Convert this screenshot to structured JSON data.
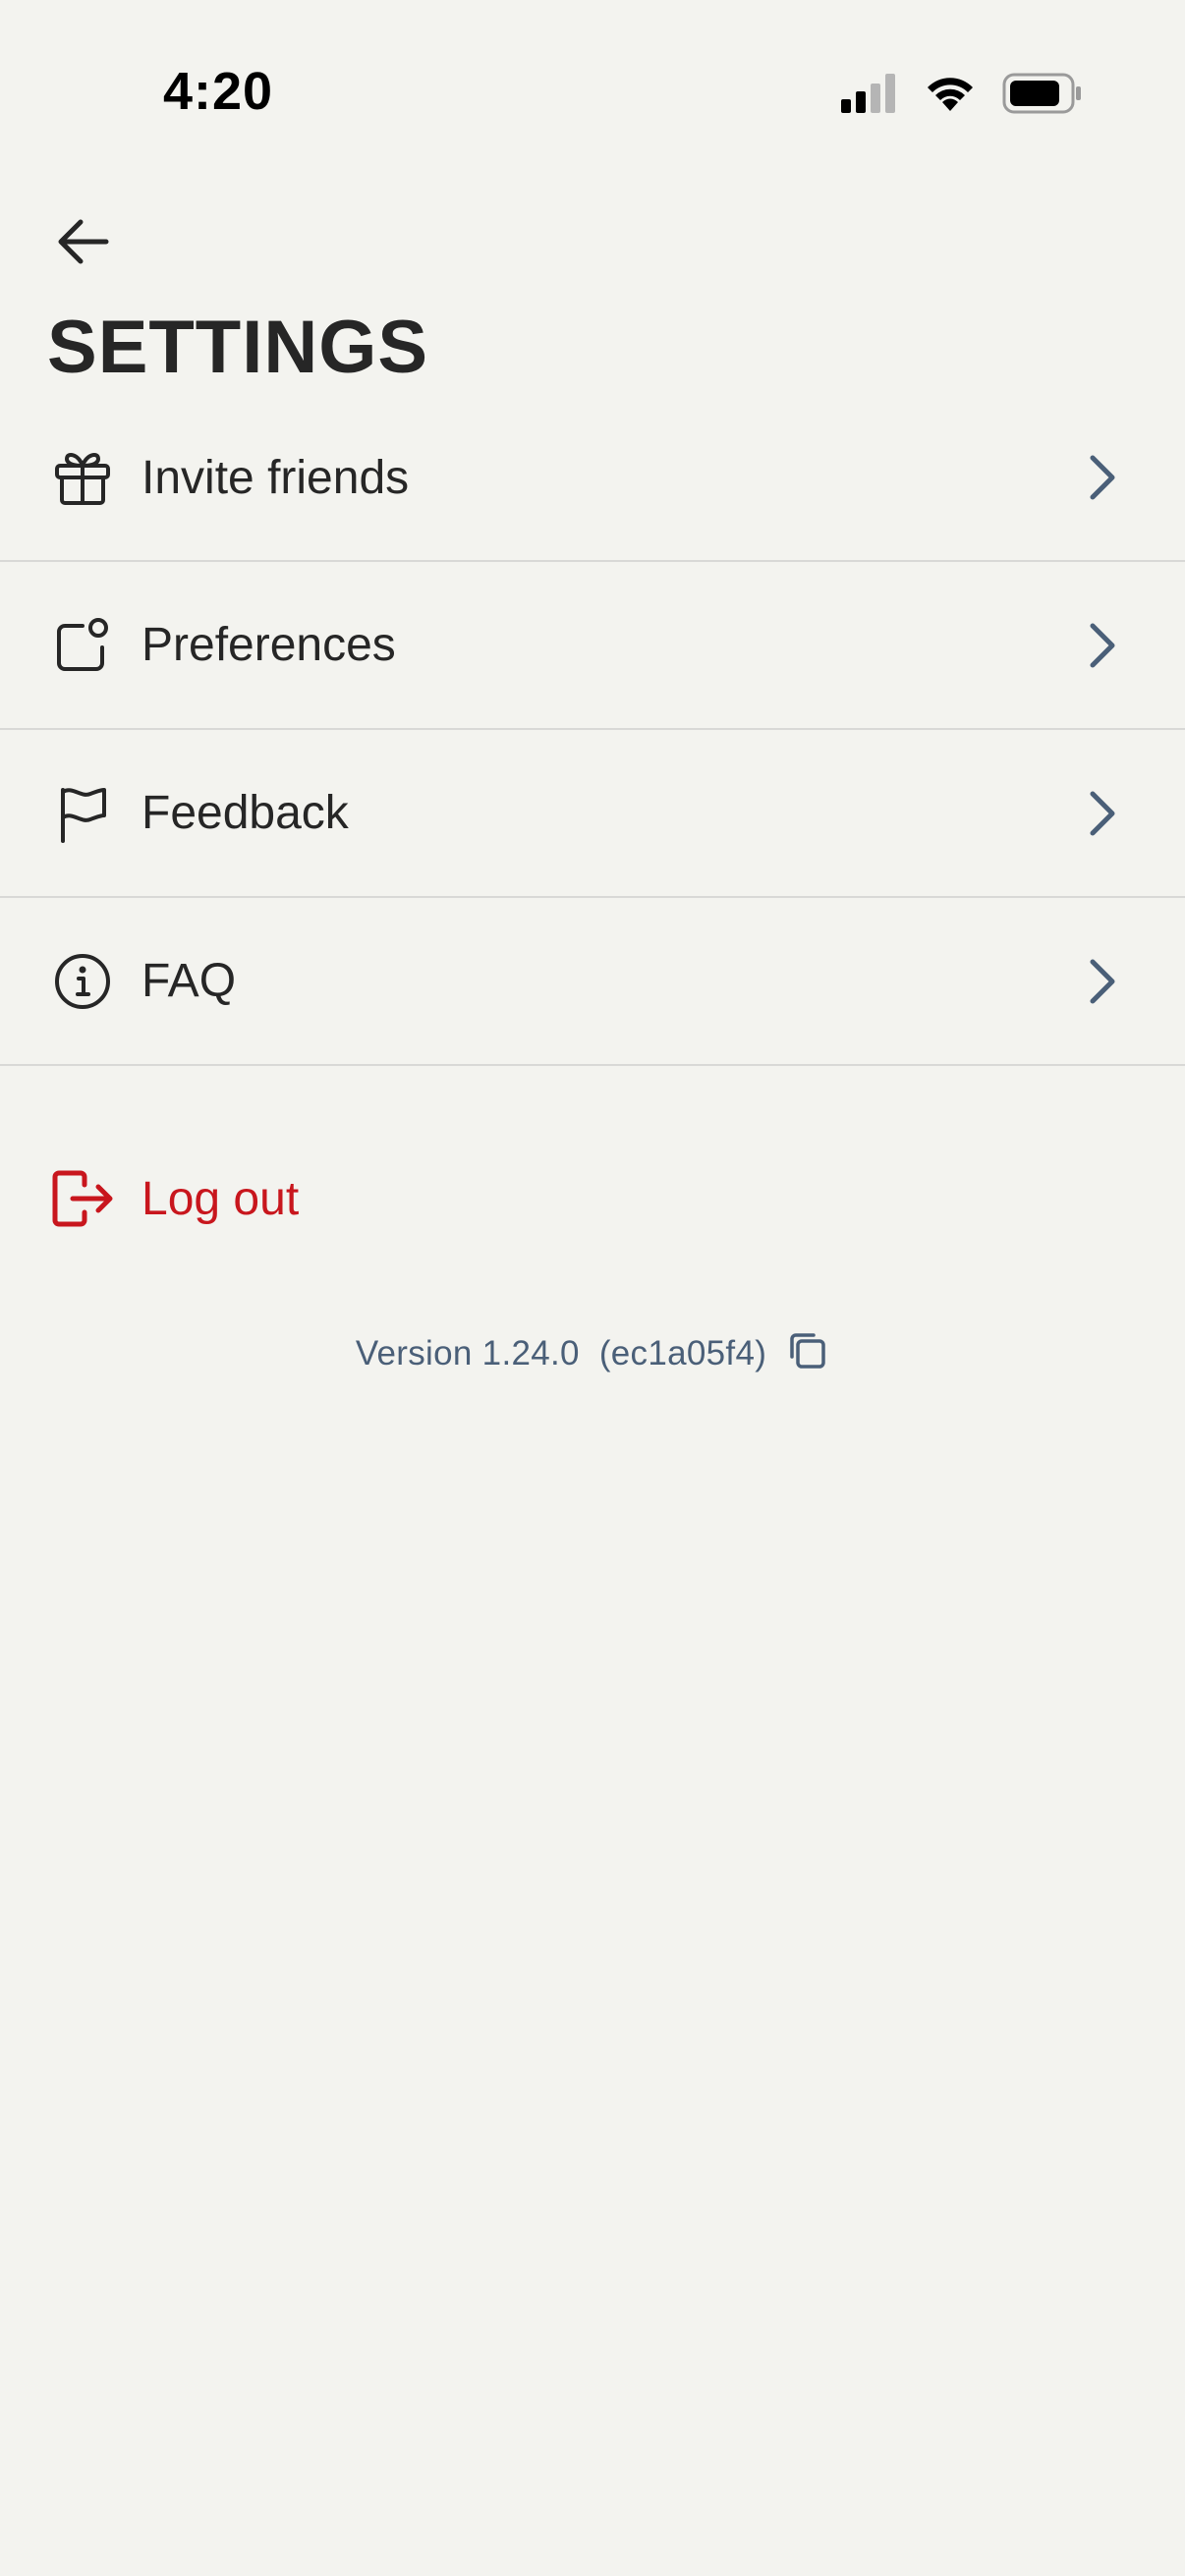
{
  "status_bar": {
    "time": "4:20",
    "icons": [
      "signal-icon",
      "wifi-icon",
      "battery-icon"
    ]
  },
  "header": {
    "back_icon": "arrow-left-icon",
    "title": "SETTINGS"
  },
  "menu": {
    "items": [
      {
        "label": "Invite friends",
        "icon": "gift-icon"
      },
      {
        "label": "Preferences",
        "icon": "preferences-icon"
      },
      {
        "label": "Feedback",
        "icon": "flag-icon"
      },
      {
        "label": "FAQ",
        "icon": "info-icon"
      }
    ],
    "chevron_icon": "chevron-right-icon"
  },
  "logout": {
    "label": "Log out",
    "icon": "logout-icon"
  },
  "version": {
    "text": "Version 1.24.0  (ec1a05f4)",
    "copy_icon": "copy-icon"
  },
  "colors": {
    "background": "#f3f3ef",
    "text": "#262626",
    "divider": "#d8d8d6",
    "danger": "#c8161d",
    "muted": "#4a5f78"
  }
}
